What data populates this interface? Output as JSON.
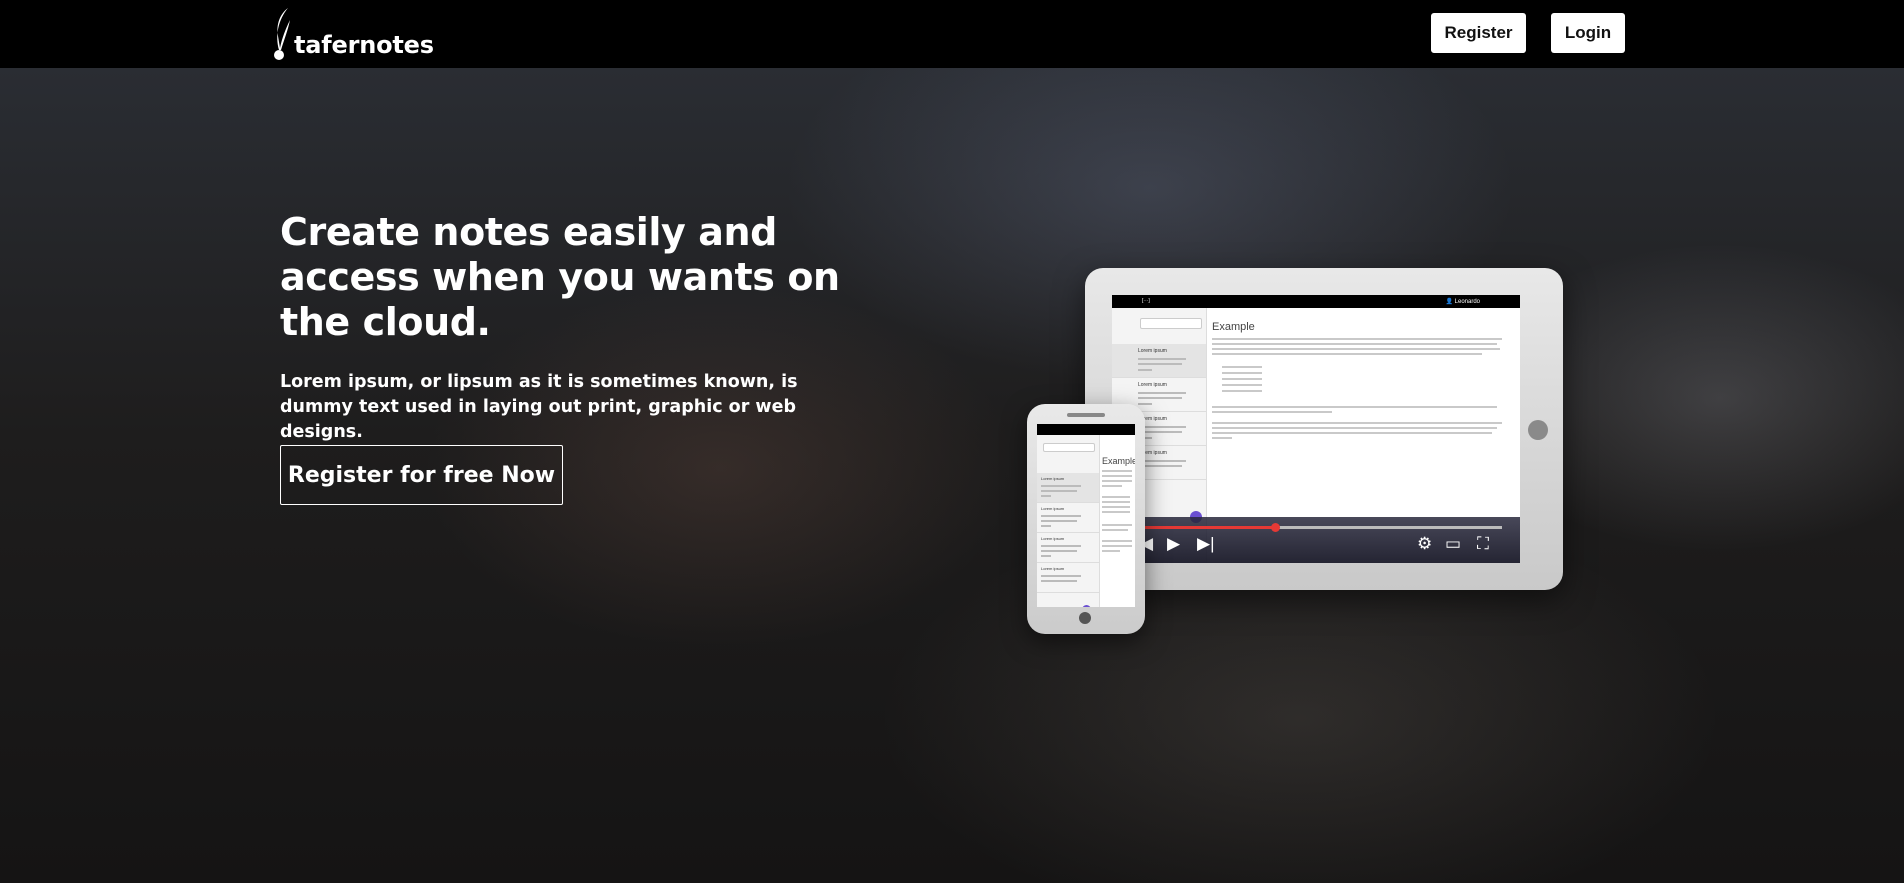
{
  "header": {
    "brand": "tafernotes",
    "register_label": "Register",
    "login_label": "Login"
  },
  "hero": {
    "headline": "Create notes easily and access when you wants on the cloud.",
    "subtext": "Lorem ipsum, or lipsum as it is sometimes known, is dummy text used in laying out print, graphic or web designs.",
    "cta_label": "Register for free Now"
  },
  "mockup": {
    "note_title": "Example",
    "user_label": "Leonardo",
    "list_item_title": "Lorem ipsum"
  },
  "icons": [
    "quill-logo-icon",
    "user-icon",
    "skip-back-icon",
    "play-icon",
    "skip-forward-icon",
    "settings-gear-icon",
    "theater-mode-icon",
    "fullscreen-icon",
    "add-note-icon"
  ]
}
